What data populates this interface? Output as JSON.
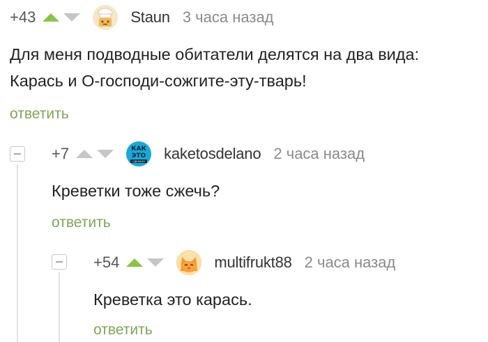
{
  "comments": [
    {
      "rating": "+43",
      "vote_state": "up",
      "username": "Staun",
      "time": "3 часа назад",
      "text_lines": [
        "Для меня подводные обитатели делятся на два вида:",
        "Карась и О-господи-сожгите-эту-тварь!"
      ],
      "reply_label": "ответить",
      "avatar_icon": "chef-avatar-icon"
    },
    {
      "rating": "+7",
      "vote_state": "none",
      "username": "kaketosdelano",
      "time": "2 часа назад",
      "text_lines": [
        "Креветки тоже сжечь?"
      ],
      "reply_label": "ответить",
      "avatar_icon": "kak-eto-avatar-icon",
      "avatar_text": [
        "КАК",
        "ЭТО",
        "СДЕЛАНО"
      ]
    },
    {
      "rating": "+54",
      "vote_state": "up",
      "username": "multifrukt88",
      "time": "2 часа назад",
      "text_lines": [
        "Креветка это карась."
      ],
      "reply_label": "ответить",
      "avatar_icon": "orange-cat-avatar-icon"
    }
  ],
  "colors": {
    "vote_up_active": "#8bc34a",
    "vote_inactive": "#c6c6c6",
    "reply_link": "#7fa45a",
    "time_text": "#8a8a8a"
  }
}
